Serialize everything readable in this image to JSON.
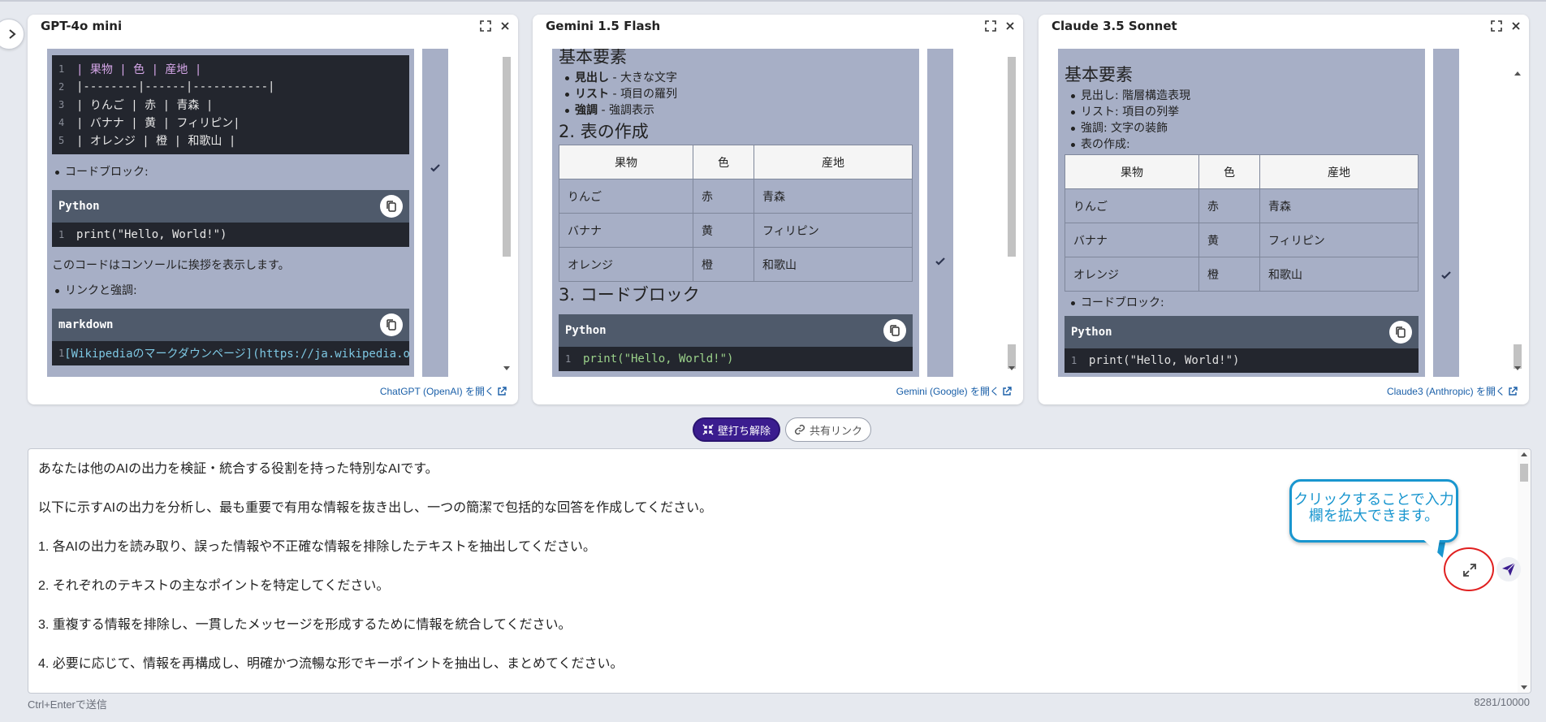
{
  "panels": [
    {
      "title": "GPT-4o mini",
      "table_code": [
        "| 果物   | 色   | 産地      |",
        "|--------|------|-----------|",
        "| りんご | 赤   | 青森      |",
        "| バナナ | 黄   | フィリピン|",
        "| オレンジ | 橙  | 和歌山    |"
      ],
      "bullet_codeblock": "コードブロック:",
      "python_label": "Python",
      "python_code": "print(\"Hello, World!\")",
      "para_console": "このコードはコンソールに挨拶を表示します。",
      "bullet_links": "リンクと強調:",
      "markdown_label": "markdown",
      "markdown_code": "[Wikipediaのマークダウンページ](https://ja.wikipedia.org",
      "footer_link": "ChatGPT (OpenAI) を開く"
    },
    {
      "title": "Gemini 1.5 Flash",
      "heading_basic": "基本要素",
      "bullets": [
        {
          "bold": "見出し",
          "text": " - 大きな文字"
        },
        {
          "bold": "リスト",
          "text": " - 項目の羅列"
        },
        {
          "bold": "強調",
          "text": " - 強調表示"
        }
      ],
      "heading_table": "2. 表の作成",
      "table_headers": [
        "果物",
        "色",
        "産地"
      ],
      "table_rows": [
        [
          "りんご",
          "赤",
          "青森"
        ],
        [
          "バナナ",
          "黄",
          "フィリピン"
        ],
        [
          "オレンジ",
          "橙",
          "和歌山"
        ]
      ],
      "heading_code": "3. コードブロック",
      "python_label": "Python",
      "python_code": "print(\"Hello, World!\")",
      "footer_link": "Gemini (Google) を開く"
    },
    {
      "title": "Claude 3.5 Sonnet",
      "heading_basic": "基本要素",
      "bullets": [
        "見出し: 階層構造表現",
        "リスト: 項目の列挙",
        "強調: 文字の装飾",
        "表の作成:"
      ],
      "table_headers": [
        "果物",
        "色",
        "産地"
      ],
      "table_rows": [
        [
          "りんご",
          "赤",
          "青森"
        ],
        [
          "バナナ",
          "黄",
          "フィリピン"
        ],
        [
          "オレンジ",
          "橙",
          "和歌山"
        ]
      ],
      "bullet_codeblock": "コードブロック:",
      "python_label": "Python",
      "python_code": "print(\"Hello, World!\")",
      "footer_link": "Claude3 (Anthropic) を開く"
    }
  ],
  "actions": {
    "wall_release": "壁打ち解除",
    "share_link": "共有リンク"
  },
  "prompt_lines": [
    "あなたは他のAIの出力を検証・統合する役割を持った特別なAIです。",
    "以下に示すAIの出力を分析し、最も重要で有用な情報を抜き出し、一つの簡潔で包括的な回答を作成してください。",
    "1. 各AIの出力を読み取り、誤った情報や不正確な情報を排除したテキストを抽出してください。",
    "2. それぞれのテキストの主なポイントを特定してください。",
    "3. 重複する情報を排除し、一貫したメッセージを形成するために情報を統合してください。",
    "4. 必要に応じて、情報を再構成し、明確かつ流暢な形でキーポイントを抽出し、まとめてください。"
  ],
  "tooltip": {
    "line1": "クリックすることで入力",
    "line2": "欄を拡大できます。"
  },
  "footer": {
    "hint": "Ctrl+Enterで送信",
    "counter": "8281/10000"
  },
  "colors": {
    "accent": "#3b1d8f",
    "tooltip": "#1996cf",
    "highlight_circle": "#e02020",
    "response_bg": "#a7afc6"
  }
}
